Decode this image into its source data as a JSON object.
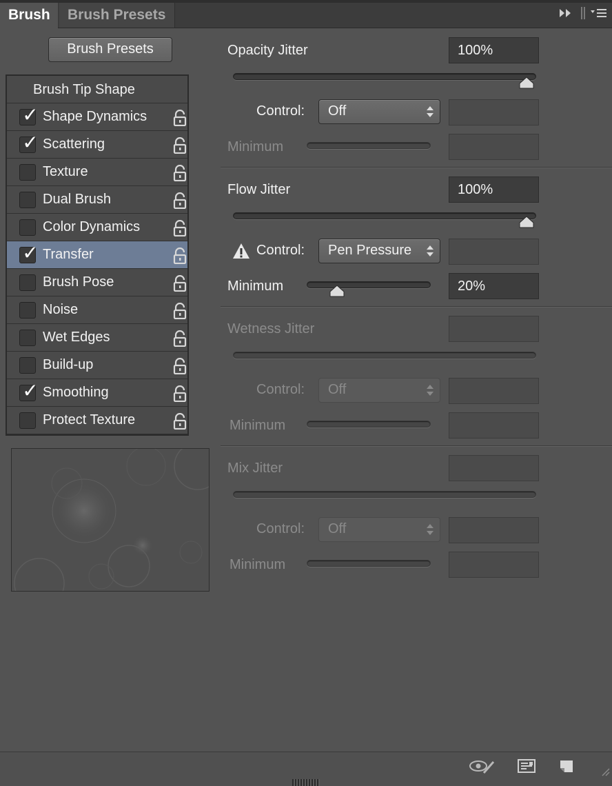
{
  "tabs": [
    {
      "label": "Brush",
      "active": true
    },
    {
      "label": "Brush Presets",
      "active": false
    }
  ],
  "presets_button": "Brush Presets",
  "options_header": "Brush Tip Shape",
  "options": [
    {
      "label": "Shape Dynamics",
      "checked": true
    },
    {
      "label": "Scattering",
      "checked": true
    },
    {
      "label": "Texture",
      "checked": false
    },
    {
      "label": "Dual Brush",
      "checked": false
    },
    {
      "label": "Color Dynamics",
      "checked": false
    },
    {
      "label": "Transfer",
      "checked": true,
      "selected": true
    },
    {
      "label": "Brush Pose",
      "checked": false
    },
    {
      "label": "Noise",
      "checked": false
    },
    {
      "label": "Wet Edges",
      "checked": false
    },
    {
      "label": "Build-up",
      "checked": false
    },
    {
      "label": "Smoothing",
      "checked": true
    },
    {
      "label": "Protect Texture",
      "checked": false
    }
  ],
  "check_glyph": "✓",
  "control_label": "Control:",
  "minimum_label": "Minimum",
  "opacity": {
    "label": "Opacity Jitter",
    "value": "100%",
    "level": 1.0,
    "control": "Off"
  },
  "flow": {
    "label": "Flow Jitter",
    "value": "100%",
    "level": 1.0,
    "control": "Pen Pressure",
    "minimum": "20%",
    "minimum_level": 0.2
  },
  "wetness": {
    "label": "Wetness Jitter",
    "control": "Off"
  },
  "mix": {
    "label": "Mix Jitter",
    "control": "Off"
  },
  "colors": {
    "selected_row": "#6d7d96",
    "panel_bg": "#535353"
  }
}
